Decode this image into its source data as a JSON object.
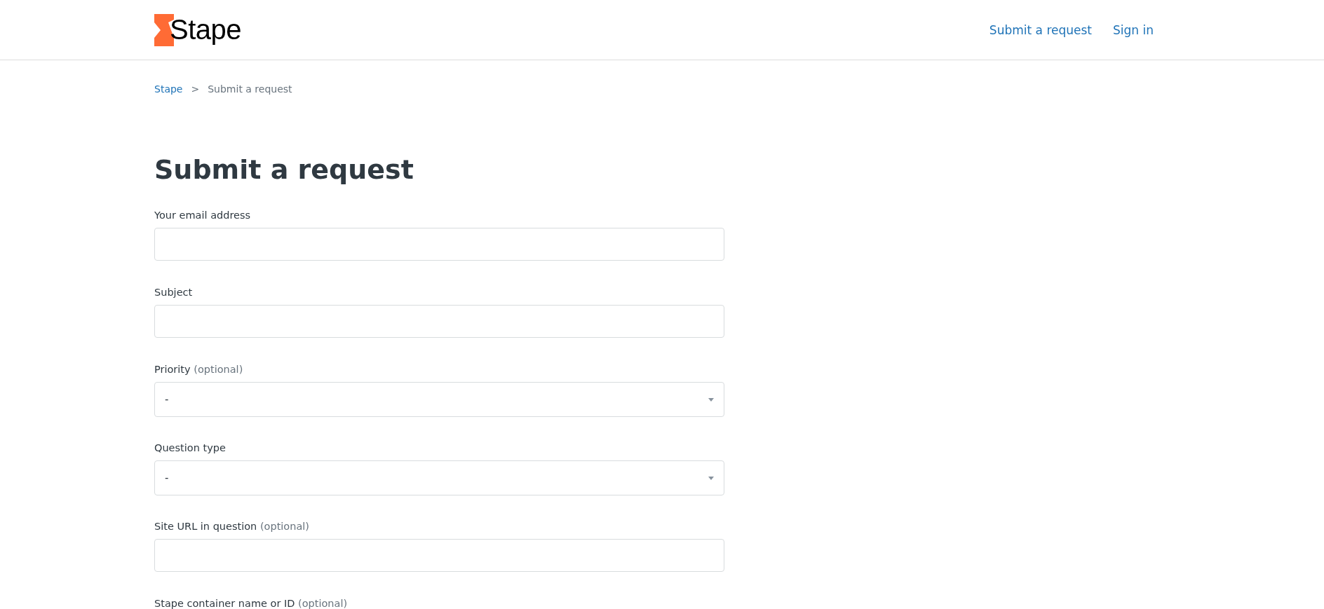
{
  "header": {
    "logo": "Stape",
    "nav": [
      "Submit a request",
      "Sign in"
    ]
  },
  "breadcrumbs": [
    {
      "label": "Stape",
      "link": true
    },
    {
      "label": ">",
      "link": false
    },
    {
      "label": "Submit a request",
      "link": false
    }
  ],
  "title": "Submit a request",
  "fields": [
    {
      "kind": "text",
      "label": "Your email address"
    },
    {
      "kind": "text",
      "label": "Subject"
    },
    {
      "kind": "select",
      "label": "Priority",
      "note": "(optional)",
      "value": "-"
    },
    {
      "kind": "select",
      "label": "Question type",
      "value": "-"
    },
    {
      "kind": "text",
      "label": "Site URL in question",
      "note": "(optional)"
    },
    {
      "kind": "text",
      "label": "Stape container name or ID",
      "note": "(optional)",
      "cut": true
    }
  ]
}
